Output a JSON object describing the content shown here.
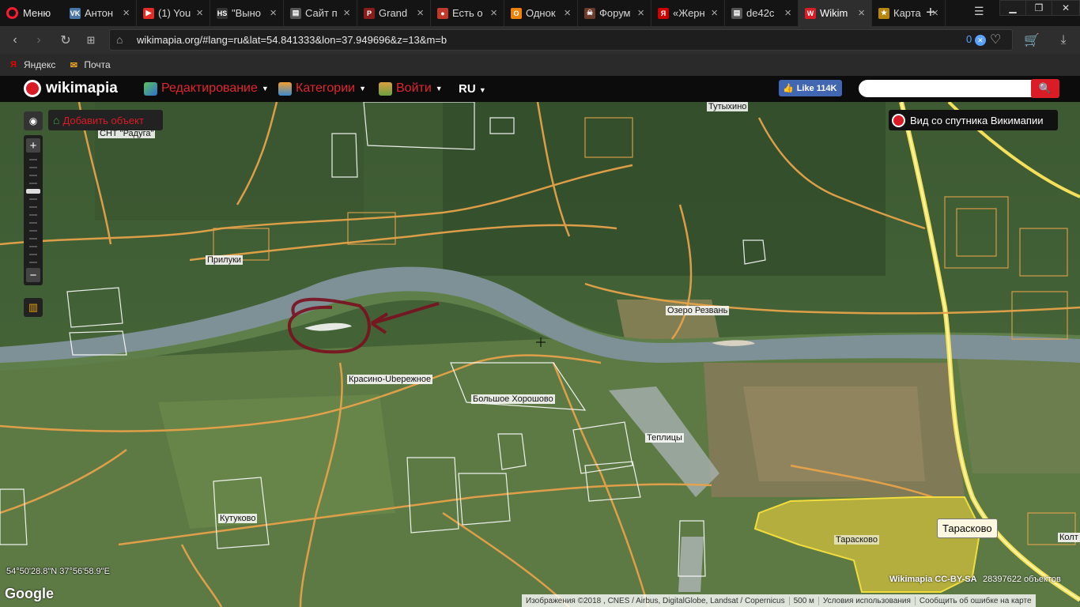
{
  "browser": {
    "menu_label": "Меню",
    "tabs": [
      {
        "label": "Антон",
        "color": "#4a76a8",
        "glyph": "VK"
      },
      {
        "label": "(1) You",
        "color": "#e52d27",
        "glyph": "▶"
      },
      {
        "label": "\"Выно",
        "color": "#333333",
        "glyph": "HS"
      },
      {
        "label": "Сайт п",
        "color": "#555555",
        "glyph": "▤"
      },
      {
        "label": "Grand",
        "color": "#8b1c1c",
        "glyph": "P"
      },
      {
        "label": "Есть о",
        "color": "#c0392b",
        "glyph": "●"
      },
      {
        "label": "Однок",
        "color": "#ee8208",
        "glyph": "О"
      },
      {
        "label": "Форум",
        "color": "#6b3b2b",
        "glyph": "☠"
      },
      {
        "label": "«Жерн",
        "color": "#cc0000",
        "glyph": "Я"
      },
      {
        "label": "de42c",
        "color": "#555555",
        "glyph": "▤"
      },
      {
        "label": "Wikim",
        "color": "#d91c26",
        "glyph": "W",
        "active": true
      },
      {
        "label": "Карта",
        "color": "#b8860b",
        "glyph": "★"
      }
    ],
    "url": "wikimapia.org/#lang=ru&lat=54.841333&lon=37.949696&z=13&m=b",
    "url_badge": "0",
    "bookmarks": [
      {
        "label": "Яндекс",
        "icon": "yandex-icon"
      },
      {
        "label": "Почта",
        "icon": "mail-icon"
      }
    ]
  },
  "wikimapia": {
    "logo": "wikimapia",
    "nav": [
      {
        "label": "Редактирование",
        "icon": "edit-icon"
      },
      {
        "label": "Категории",
        "icon": "categories-icon"
      },
      {
        "label": "Войти",
        "icon": "login-icon"
      }
    ],
    "lang": "RU",
    "fb_like": "Like 114K",
    "search_placeholder": ""
  },
  "map": {
    "add_object": "Добавить объект",
    "satellite_view": "Вид со спутника Викимапии",
    "coords": "54°50'28.8\"N 37°56'58.9\"E",
    "google": "Google",
    "license": "Wikimapia CC-BY-SA",
    "object_count": "28397622 объектов",
    "attribution": [
      "Изображения ©2018 , CNES / Airbus, DigitalGlobe, Landsat / Copernicus",
      "500 м",
      "Условия использования",
      "Сообщить об ошибке на карте"
    ],
    "tooltip": "Тарасково",
    "places": [
      {
        "name": "СНТ \"Радуга\"",
        "id": "raduga"
      },
      {
        "name": "Тутыхино",
        "id": "tutykhino"
      },
      {
        "name": "Прилуки",
        "id": "priluki"
      },
      {
        "name": "Озеро Резвань",
        "id": "rezvan"
      },
      {
        "name": "Красино-Ubережное",
        "id": "krasino"
      },
      {
        "name": "Большое Хорошово",
        "id": "khoroshovo"
      },
      {
        "name": "Теплицы",
        "id": "teplitsy"
      },
      {
        "name": "Кутуково",
        "id": "kutukovo"
      },
      {
        "name": "Тарасково",
        "id": "taraskovo"
      },
      {
        "name": "Колт",
        "id": "kolt"
      }
    ]
  }
}
